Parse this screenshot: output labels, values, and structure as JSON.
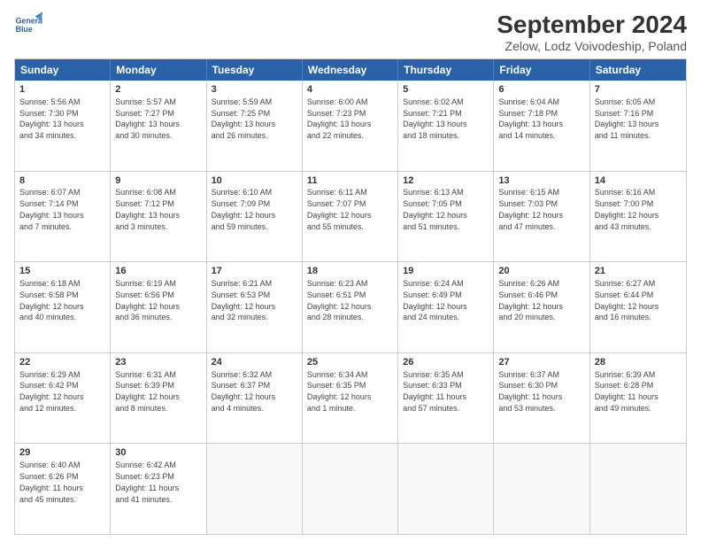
{
  "logo": {
    "line1": "General",
    "line2": "Blue"
  },
  "title": "September 2024",
  "subtitle": "Zelow, Lodz Voivodeship, Poland",
  "headers": [
    "Sunday",
    "Monday",
    "Tuesday",
    "Wednesday",
    "Thursday",
    "Friday",
    "Saturday"
  ],
  "rows": [
    [
      {
        "day": "1",
        "text": "Sunrise: 5:56 AM\nSunset: 7:30 PM\nDaylight: 13 hours\nand 34 minutes."
      },
      {
        "day": "2",
        "text": "Sunrise: 5:57 AM\nSunset: 7:27 PM\nDaylight: 13 hours\nand 30 minutes."
      },
      {
        "day": "3",
        "text": "Sunrise: 5:59 AM\nSunset: 7:25 PM\nDaylight: 13 hours\nand 26 minutes."
      },
      {
        "day": "4",
        "text": "Sunrise: 6:00 AM\nSunset: 7:23 PM\nDaylight: 13 hours\nand 22 minutes."
      },
      {
        "day": "5",
        "text": "Sunrise: 6:02 AM\nSunset: 7:21 PM\nDaylight: 13 hours\nand 18 minutes."
      },
      {
        "day": "6",
        "text": "Sunrise: 6:04 AM\nSunset: 7:18 PM\nDaylight: 13 hours\nand 14 minutes."
      },
      {
        "day": "7",
        "text": "Sunrise: 6:05 AM\nSunset: 7:16 PM\nDaylight: 13 hours\nand 11 minutes."
      }
    ],
    [
      {
        "day": "8",
        "text": "Sunrise: 6:07 AM\nSunset: 7:14 PM\nDaylight: 13 hours\nand 7 minutes."
      },
      {
        "day": "9",
        "text": "Sunrise: 6:08 AM\nSunset: 7:12 PM\nDaylight: 13 hours\nand 3 minutes."
      },
      {
        "day": "10",
        "text": "Sunrise: 6:10 AM\nSunset: 7:09 PM\nDaylight: 12 hours\nand 59 minutes."
      },
      {
        "day": "11",
        "text": "Sunrise: 6:11 AM\nSunset: 7:07 PM\nDaylight: 12 hours\nand 55 minutes."
      },
      {
        "day": "12",
        "text": "Sunrise: 6:13 AM\nSunset: 7:05 PM\nDaylight: 12 hours\nand 51 minutes."
      },
      {
        "day": "13",
        "text": "Sunrise: 6:15 AM\nSunset: 7:03 PM\nDaylight: 12 hours\nand 47 minutes."
      },
      {
        "day": "14",
        "text": "Sunrise: 6:16 AM\nSunset: 7:00 PM\nDaylight: 12 hours\nand 43 minutes."
      }
    ],
    [
      {
        "day": "15",
        "text": "Sunrise: 6:18 AM\nSunset: 6:58 PM\nDaylight: 12 hours\nand 40 minutes."
      },
      {
        "day": "16",
        "text": "Sunrise: 6:19 AM\nSunset: 6:56 PM\nDaylight: 12 hours\nand 36 minutes."
      },
      {
        "day": "17",
        "text": "Sunrise: 6:21 AM\nSunset: 6:53 PM\nDaylight: 12 hours\nand 32 minutes."
      },
      {
        "day": "18",
        "text": "Sunrise: 6:23 AM\nSunset: 6:51 PM\nDaylight: 12 hours\nand 28 minutes."
      },
      {
        "day": "19",
        "text": "Sunrise: 6:24 AM\nSunset: 6:49 PM\nDaylight: 12 hours\nand 24 minutes."
      },
      {
        "day": "20",
        "text": "Sunrise: 6:26 AM\nSunset: 6:46 PM\nDaylight: 12 hours\nand 20 minutes."
      },
      {
        "day": "21",
        "text": "Sunrise: 6:27 AM\nSunset: 6:44 PM\nDaylight: 12 hours\nand 16 minutes."
      }
    ],
    [
      {
        "day": "22",
        "text": "Sunrise: 6:29 AM\nSunset: 6:42 PM\nDaylight: 12 hours\nand 12 minutes."
      },
      {
        "day": "23",
        "text": "Sunrise: 6:31 AM\nSunset: 6:39 PM\nDaylight: 12 hours\nand 8 minutes."
      },
      {
        "day": "24",
        "text": "Sunrise: 6:32 AM\nSunset: 6:37 PM\nDaylight: 12 hours\nand 4 minutes."
      },
      {
        "day": "25",
        "text": "Sunrise: 6:34 AM\nSunset: 6:35 PM\nDaylight: 12 hours\nand 1 minute."
      },
      {
        "day": "26",
        "text": "Sunrise: 6:35 AM\nSunset: 6:33 PM\nDaylight: 11 hours\nand 57 minutes."
      },
      {
        "day": "27",
        "text": "Sunrise: 6:37 AM\nSunset: 6:30 PM\nDaylight: 11 hours\nand 53 minutes."
      },
      {
        "day": "28",
        "text": "Sunrise: 6:39 AM\nSunset: 6:28 PM\nDaylight: 11 hours\nand 49 minutes."
      }
    ],
    [
      {
        "day": "29",
        "text": "Sunrise: 6:40 AM\nSunset: 6:26 PM\nDaylight: 11 hours\nand 45 minutes."
      },
      {
        "day": "30",
        "text": "Sunrise: 6:42 AM\nSunset: 6:23 PM\nDaylight: 11 hours\nand 41 minutes."
      },
      {
        "day": "",
        "text": ""
      },
      {
        "day": "",
        "text": ""
      },
      {
        "day": "",
        "text": ""
      },
      {
        "day": "",
        "text": ""
      },
      {
        "day": "",
        "text": ""
      }
    ]
  ]
}
